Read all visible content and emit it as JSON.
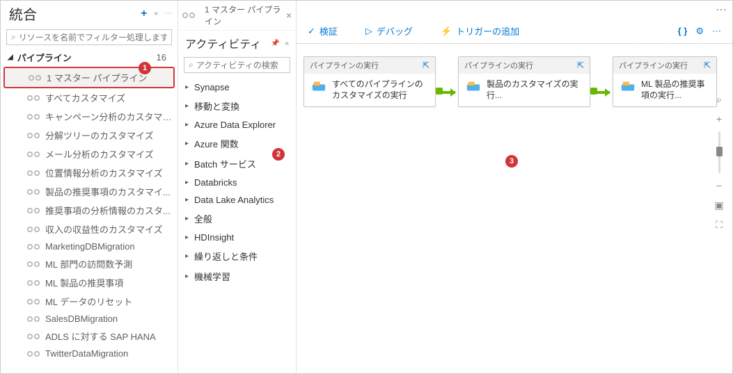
{
  "sidebar": {
    "title": "統合",
    "search_placeholder": "リソースを名前でフィルター処理します",
    "section_label": "パイプライン",
    "section_count": "16",
    "items": [
      "1 マスター パイプライン",
      "すべてカスタマイズ",
      "キャンペーン分析のカスタマイズ",
      "分解ツリーのカスタマイズ",
      "メール分析のカスタマイズ",
      "位置情報分析のカスタマイズ",
      "製品の推奨事項のカスタマイ...",
      "推奨事項の分析情報のカスタ...",
      "収入の収益性のカスタマイズ",
      "MarketingDBMigration",
      "ML 部門の訪問数予測",
      "ML 製品の推奨事項",
      "ML データのリセット",
      "SalesDBMigration",
      "ADLS に対する SAP HANA",
      "TwitterDataMigration"
    ]
  },
  "tab": {
    "label": "1 マスター パイプライン"
  },
  "activities": {
    "title": "アクティビティ",
    "search_placeholder": "アクティビティの検索",
    "items": [
      "Synapse",
      "移動と変換",
      "Azure Data Explorer",
      "Azure 関数",
      "Batch サービス",
      "Databricks",
      "Data Lake Analytics",
      "全般",
      "HDInsight",
      "繰り返しと条件",
      "機械学習"
    ]
  },
  "toolbar": {
    "validate": "検証",
    "debug": "デバッグ",
    "add_trigger": "トリガーの追加"
  },
  "nodes": {
    "header": "パイプラインの実行",
    "n1": "すべてのパイプラインのカスタマイズの実行",
    "n2": "製品のカスタマイズの実行...",
    "n3": "ML 製品の推奨事項の実行..."
  },
  "callouts": {
    "c1": "1",
    "c2": "2",
    "c3": "3"
  }
}
